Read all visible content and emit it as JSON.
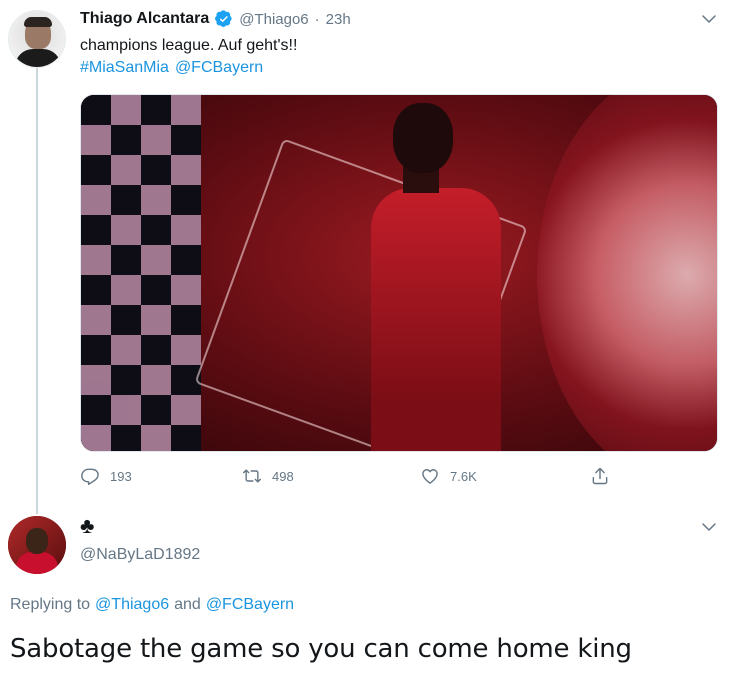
{
  "original_tweet": {
    "author_name": "Thiago Alcantara",
    "handle": "@Thiago6",
    "separator": "·",
    "time": "23h",
    "text": "champions league. Auf geht's!!",
    "hashtag": "#MiaSanMia",
    "mention": "@FCBayern",
    "stats": {
      "replies": "193",
      "retweets": "498",
      "likes": "7.6K"
    }
  },
  "reply_tweet": {
    "display_name": "♣",
    "handle": "@NaByLaD1892",
    "replying_label": "Replying to",
    "replying_to_1": "@Thiago6",
    "replying_and": "and",
    "replying_to_2": "@FCBayern",
    "text": "Sabotage the game so you can come home king"
  },
  "icons": {
    "verified": "verified-badge-icon",
    "caret": "chevron-down-icon",
    "reply": "reply-icon",
    "retweet": "retweet-icon",
    "like": "heart-icon",
    "share": "share-icon"
  },
  "colors": {
    "link": "#1b95e0",
    "secondary_text": "#657786",
    "primary_text": "#14171a",
    "thread_line": "#ccd6dd"
  }
}
